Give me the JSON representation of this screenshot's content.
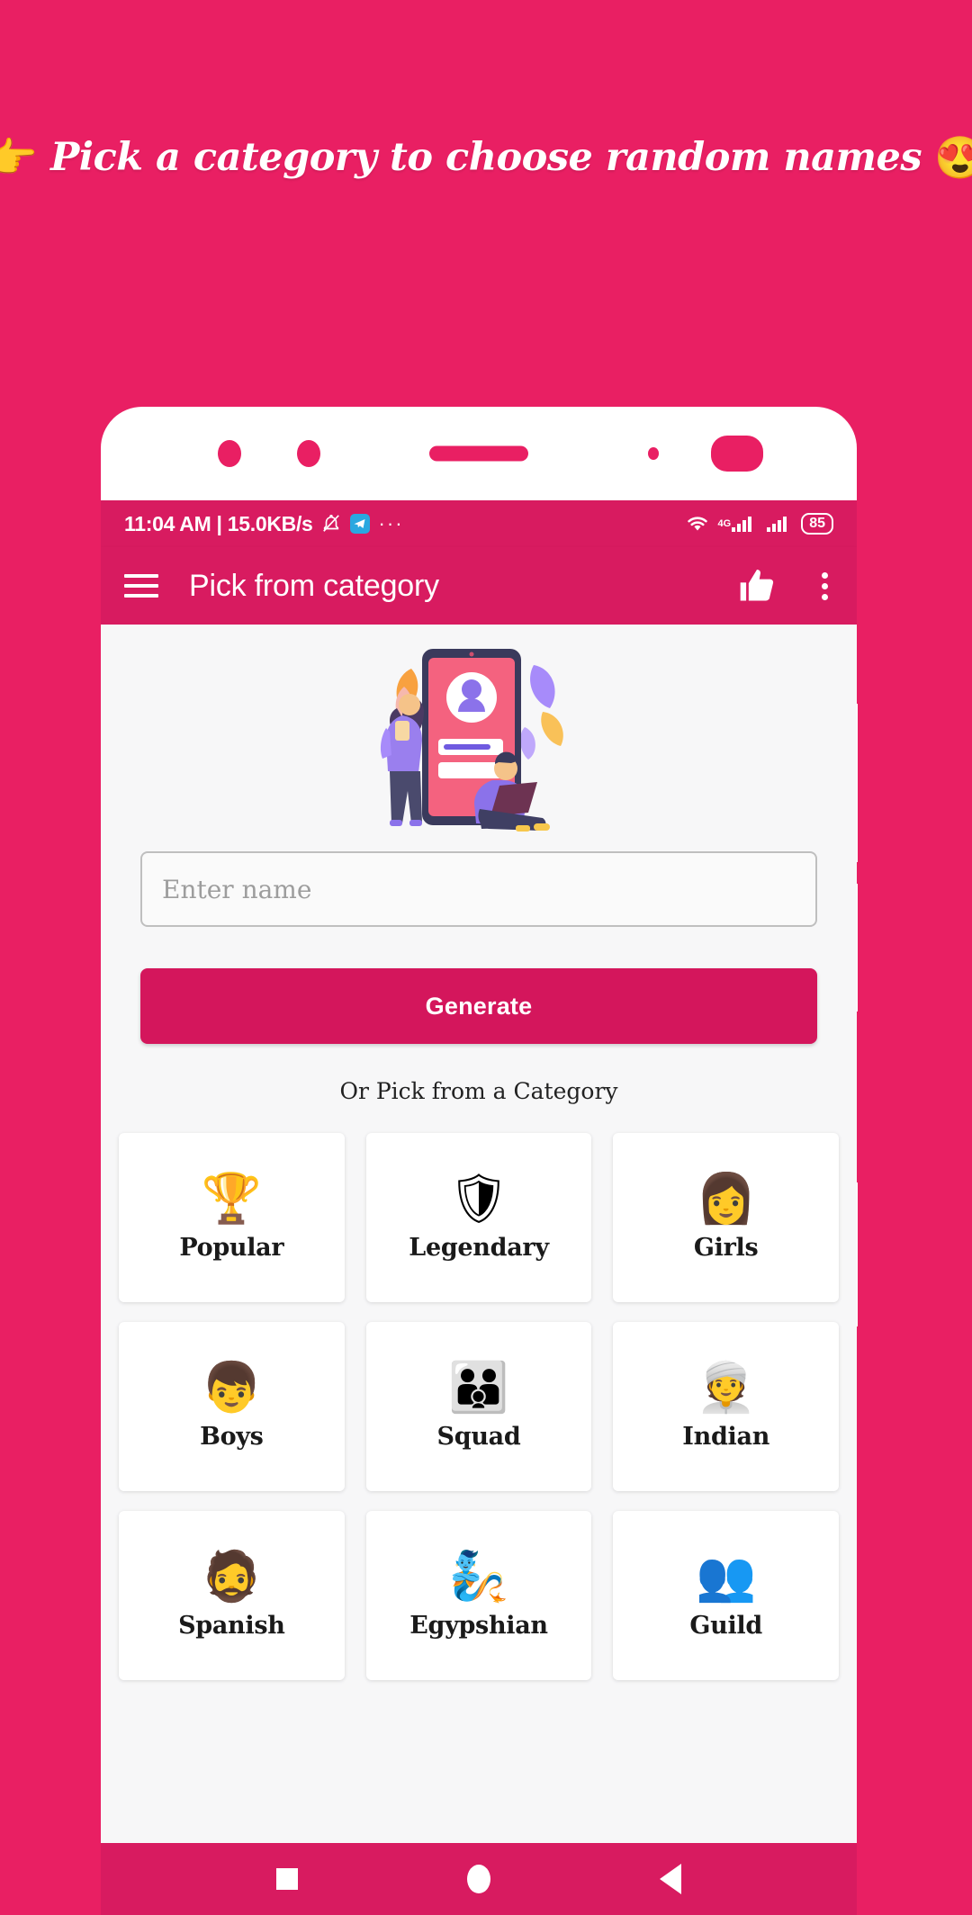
{
  "promo": {
    "pointer_emoji": "👉",
    "text": "Pick a category to choose random names",
    "heart_eyes_emoji": "😍",
    "background_color": "#e91f63",
    "text_color": "#ffffff"
  },
  "statusbar": {
    "time_and_speed": "11:04 AM | 15.0KB/s",
    "mute_icon": "bell-slash-icon",
    "app_icon": "telegram-icon",
    "overflow": "···",
    "wifi_icon": "wifi-icon",
    "network_label": "4G",
    "signal_icon": "signal-bars-icon",
    "battery_level": "85",
    "background_color": "#d81b60"
  },
  "appbar": {
    "menu_icon": "hamburger-menu-icon",
    "title": "Pick from category",
    "like_icon": "thumbs-up-icon",
    "overflow_icon": "kebab-menu-icon",
    "background_color": "#d81b60"
  },
  "hero": {
    "illustration_name": "profile-signup-illustration"
  },
  "form": {
    "name_placeholder": "Enter name",
    "name_value": "",
    "generate_label": "Generate",
    "generate_color": "#d4165c",
    "or_pick_label": "Or Pick from a Category"
  },
  "categories": [
    {
      "label": "Popular",
      "emoji": "🏆",
      "icon_name": "trophy-icon"
    },
    {
      "label": "Legendary",
      "emoji": "🛡",
      "icon_name": "shield-swords-icon"
    },
    {
      "label": "Girls",
      "emoji": "👩",
      "icon_name": "woman-icon"
    },
    {
      "label": "Boys",
      "emoji": "👦",
      "icon_name": "boy-icon"
    },
    {
      "label": "Squad",
      "emoji": "👪",
      "icon_name": "group-sparkle-icon"
    },
    {
      "label": "Indian",
      "emoji": "👳",
      "icon_name": "turban-icon"
    },
    {
      "label": "Spanish",
      "emoji": "🧔",
      "icon_name": "sombrero-mustache-icon"
    },
    {
      "label": "Egypshian",
      "emoji": "🧞",
      "icon_name": "pharaoh-icon"
    },
    {
      "label": "Guild",
      "emoji": "👥",
      "icon_name": "people-group-icon"
    }
  ],
  "navbar": {
    "recents_icon": "square-recents-icon",
    "home_icon": "circle-home-icon",
    "back_icon": "triangle-back-icon",
    "background_color": "#d81b60"
  }
}
